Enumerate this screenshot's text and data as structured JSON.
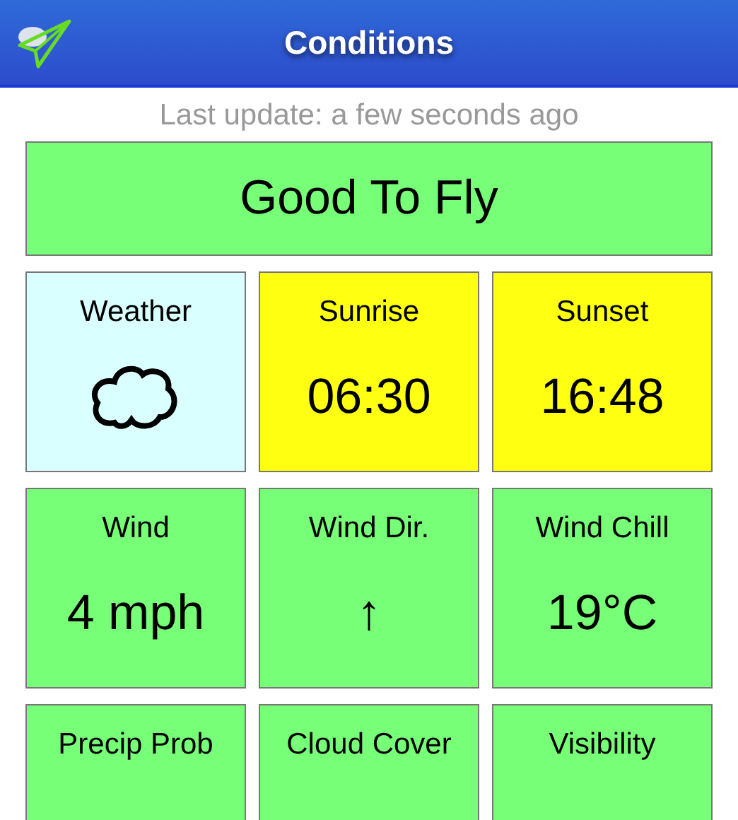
{
  "header": {
    "title": "Conditions"
  },
  "last_update": "Last update: a few seconds ago",
  "status": {
    "label": "Good To Fly",
    "color": "#77ff77"
  },
  "tiles": [
    {
      "label": "Weather",
      "kind": "icon",
      "color": "#d9ffff"
    },
    {
      "label": "Sunrise",
      "kind": "text",
      "value": "06:30",
      "color": "#ffff11"
    },
    {
      "label": "Sunset",
      "kind": "text",
      "value": "16:48",
      "color": "#ffff11"
    },
    {
      "label": "Wind",
      "kind": "text",
      "value": "4 mph",
      "color": "#77ff77"
    },
    {
      "label": "Wind Dir.",
      "kind": "text",
      "value": "↑",
      "color": "#77ff77"
    },
    {
      "label": "Wind Chill",
      "kind": "text",
      "value": "19°C",
      "color": "#77ff77"
    },
    {
      "label": "Precip Prob",
      "kind": "text",
      "color": "#77ff77"
    },
    {
      "label": "Cloud Cover",
      "kind": "text",
      "color": "#77ff77"
    },
    {
      "label": "Visibility",
      "kind": "text",
      "color": "#77ff77"
    }
  ]
}
